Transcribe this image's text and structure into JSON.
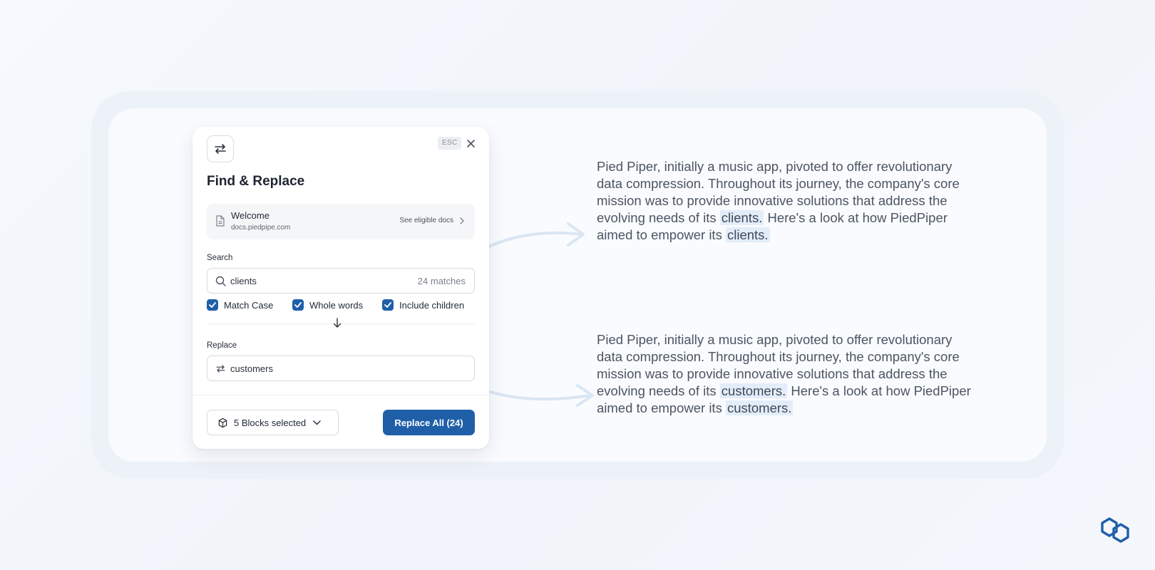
{
  "dialog": {
    "title": "Find & Replace",
    "esc_label": "ESC",
    "doc": {
      "name": "Welcome",
      "url": "docs.piedpipe.com",
      "link_label": "See eligible docs"
    },
    "search": {
      "label": "Search",
      "value": "clients",
      "matches": "24 matches"
    },
    "options": [
      {
        "label": "Match Case",
        "checked": true
      },
      {
        "label": "Whole words",
        "checked": true
      },
      {
        "label": "Include children",
        "checked": true
      }
    ],
    "replace": {
      "label": "Replace",
      "value": "customers"
    },
    "blocks_label": "5 Blocks selected",
    "replace_all_label": "Replace All (24)"
  },
  "before": {
    "lead": "Pied Piper, initially a music app, pivoted to offer revolutionary data compression. Throughout its journey, the company's core mission was to provide innovative solutions that address the evolving needs of its ",
    "term1": "clients.",
    "mid": " Here's a look at how PiedPiper aimed to empower its ",
    "term2": "clients."
  },
  "after": {
    "lead": "Pied Piper, initially a music app, pivoted to offer revolutionary data compression. Throughout its journey, the company's core mission was to provide innovative solutions that address the evolving needs of its ",
    "term1": "customers.",
    "mid": " Here's a look at how PiedPiper aimed to empower its ",
    "term2": "customers."
  },
  "colors": {
    "accent": "#1f5fa8",
    "highlight": "#e3edf9"
  },
  "icons": {
    "header": "replace-arrows-icon",
    "doc": "document-icon",
    "search": "search-icon",
    "replace": "replace-arrows-icon",
    "blocks": "cube-icon",
    "logo": "brand-logo-icon"
  }
}
